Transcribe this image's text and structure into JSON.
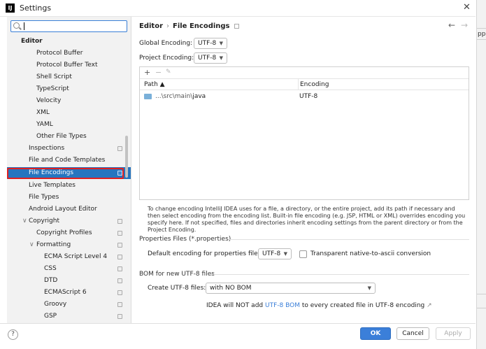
{
  "window": {
    "title": "Settings",
    "app_icon_text": "IJ"
  },
  "edge": {
    "clipped_text": "pp"
  },
  "search": {
    "placeholder": ""
  },
  "sidebar": {
    "items": [
      {
        "label": "Editor"
      },
      {
        "label": "Protocol Buffer"
      },
      {
        "label": "Protocol Buffer Text"
      },
      {
        "label": "Shell Script"
      },
      {
        "label": "TypeScript"
      },
      {
        "label": "Velocity"
      },
      {
        "label": "XML"
      },
      {
        "label": "YAML"
      },
      {
        "label": "Other File Types"
      },
      {
        "label": "Inspections"
      },
      {
        "label": "File and Code Templates"
      },
      {
        "label": "File Encodings"
      },
      {
        "label": "Live Templates"
      },
      {
        "label": "File Types"
      },
      {
        "label": "Android Layout Editor"
      },
      {
        "label": "Copyright"
      },
      {
        "label": "Copyright Profiles"
      },
      {
        "label": "Formatting"
      },
      {
        "label": "ECMA Script Level 4"
      },
      {
        "label": "CSS"
      },
      {
        "label": "DTD"
      },
      {
        "label": "ECMAScript 6"
      },
      {
        "label": "Groovy"
      },
      {
        "label": "GSP"
      }
    ],
    "selected": "File Encodings"
  },
  "header": {
    "parent": "Editor",
    "separator": "›",
    "current": "File Encodings"
  },
  "encodings": {
    "global_label": "Global Encoding:",
    "global_value": "UTF-8",
    "project_label": "Project Encoding:",
    "project_value": "UTF-8"
  },
  "table": {
    "col_path": "Path ▲",
    "col_encoding": "Encoding",
    "rows": [
      {
        "path_prefix": "...\\src\\main\\",
        "path_name": "java",
        "encoding": "UTF-8"
      }
    ]
  },
  "description": "To change encoding IntelliJ IDEA uses for a file, a directory, or the entire project, add its path if necessary and then select encoding from the encoding list. Built-in file encoding (e.g. JSP, HTML or XML) overrides encoding you specify here. If not specified, files and directories inherit encoding settings from the parent directory or from the Project Encoding.",
  "properties": {
    "section_title": "Properties Files (*.properties)",
    "default_label": "Default encoding for properties files:",
    "default_value": "UTF-8",
    "transparent_label": "Transparent native-to-ascii conversion",
    "transparent_checked": false
  },
  "bom": {
    "section_title": "BOM for new UTF-8 files",
    "create_label": "Create UTF-8 files:",
    "create_value": "with NO BOM",
    "note_prefix": "IDEA will NOT add",
    "note_link": "UTF-8 BOM",
    "note_suffix": "to every created file in UTF-8 encoding",
    "link_color": "#3b7fd9"
  },
  "footer": {
    "help": "?",
    "ok": "OK",
    "cancel": "Cancel",
    "apply": "Apply"
  },
  "colors": {
    "selection": "#2675bf",
    "highlight_border": "#e02020",
    "primary_button": "#3b7fd9"
  }
}
